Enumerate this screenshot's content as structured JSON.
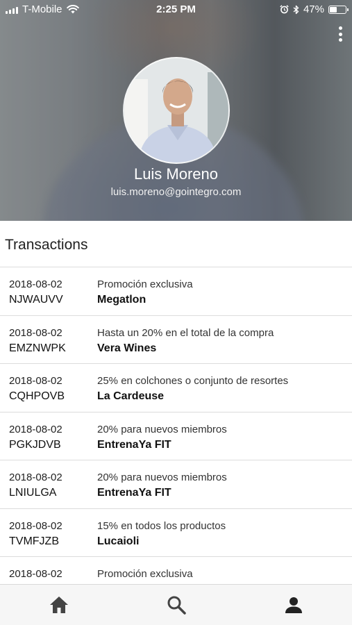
{
  "status_bar": {
    "carrier": "T-Mobile",
    "time": "2:25 PM",
    "battery": "47%",
    "battery_level": 0.47,
    "icons": [
      "signal-icon",
      "wifi-icon",
      "alarm-icon",
      "bluetooth-icon",
      "battery-icon"
    ]
  },
  "profile": {
    "name": "Luis Moreno",
    "email": "luis.moreno@gointegro.com",
    "menu_icon": "more-vertical-icon"
  },
  "transactions": {
    "title": "Transactions",
    "items": [
      {
        "date": "2018-08-02",
        "code": "NJWAUVV",
        "description": "Promoción exclusiva",
        "merchant": "Megatlon"
      },
      {
        "date": "2018-08-02",
        "code": "EMZNWPK",
        "description": "Hasta un 20% en el total de la compra",
        "merchant": "Vera Wines"
      },
      {
        "date": "2018-08-02",
        "code": "CQHPOVB",
        "description": "25% en colchones o conjunto de resortes",
        "merchant": "La Cardeuse"
      },
      {
        "date": "2018-08-02",
        "code": "PGKJDVB",
        "description": "20% para nuevos miembros",
        "merchant": "EntrenaYa FIT"
      },
      {
        "date": "2018-08-02",
        "code": "LNIULGA",
        "description": "20% para nuevos miembros",
        "merchant": "EntrenaYa FIT"
      },
      {
        "date": "2018-08-02",
        "code": "TVMFJZB",
        "description": "15% en todos los productos",
        "merchant": "Lucaioli"
      },
      {
        "date": "2018-08-02",
        "code": "",
        "description": "Promoción exclusiva",
        "merchant": ""
      }
    ]
  },
  "bottom_nav": {
    "items": [
      {
        "icon": "home-icon"
      },
      {
        "icon": "search-icon"
      },
      {
        "icon": "profile-icon"
      }
    ]
  },
  "colors": {
    "nav_icon": "#444444",
    "divider": "#dcdcdc",
    "nav_background": "#f6f6f6"
  }
}
